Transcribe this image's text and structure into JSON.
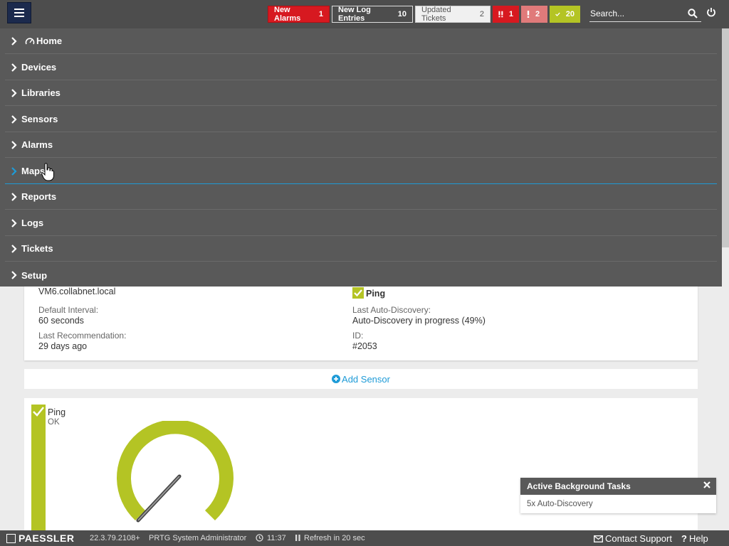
{
  "topbar": {
    "new_alarms_label": "New Alarms",
    "new_alarms_count": "1",
    "new_log_label": "New Log Entries",
    "new_log_count": "10",
    "tickets_label": "Updated Tickets",
    "tickets_count": "2",
    "down_count": "1",
    "warning_count": "2",
    "ok_count": "20",
    "search_placeholder": "Search..."
  },
  "nav": {
    "items": [
      {
        "label": "Home"
      },
      {
        "label": "Devices"
      },
      {
        "label": "Libraries"
      },
      {
        "label": "Sensors"
      },
      {
        "label": "Alarms"
      },
      {
        "label": "Maps"
      },
      {
        "label": "Reports"
      },
      {
        "label": "Logs"
      },
      {
        "label": "Tickets"
      },
      {
        "label": "Setup"
      }
    ]
  },
  "device_info": {
    "host": "VM6.collabnet.local",
    "interval_label": "Default Interval:",
    "interval_value": "60 seconds",
    "recommendation_label": "Last Recommendation:",
    "recommendation_value": "29 days ago",
    "sensor_label": "Ping",
    "discovery_label": "Last Auto-Discovery:",
    "discovery_value": "Auto-Discovery in progress (49%)",
    "id_label": "ID:",
    "id_value": "#2053"
  },
  "add_sensor_label": "Add Sensor",
  "sensor": {
    "name": "Ping",
    "status": "OK"
  },
  "bg_tasks": {
    "title": "Active Background Tasks",
    "item": "5x Auto-Discovery"
  },
  "footer": {
    "brand": "PAESSLER",
    "version": "22.3.79.2108+",
    "user": "PRTG System Administrator",
    "time": "11:37",
    "refresh": "Refresh in 20 sec",
    "contact": "Contact Support",
    "help": "Help"
  },
  "colors": {
    "alarm_red": "#d71920",
    "ok_green": "#b4c424",
    "warning_pink": "#e07a7a",
    "link_blue": "#1e9bd7",
    "nav_bg": "#595959",
    "topbar_bg": "#4d4d4d"
  },
  "icons": [
    "menu-icon",
    "search-icon",
    "power-icon",
    "chevron-right-icon",
    "home-gauge-icon",
    "check-icon",
    "exclamation-icon",
    "plus-circle-icon",
    "close-icon",
    "clock-icon",
    "pause-icon",
    "envelope-icon",
    "question-icon"
  ]
}
